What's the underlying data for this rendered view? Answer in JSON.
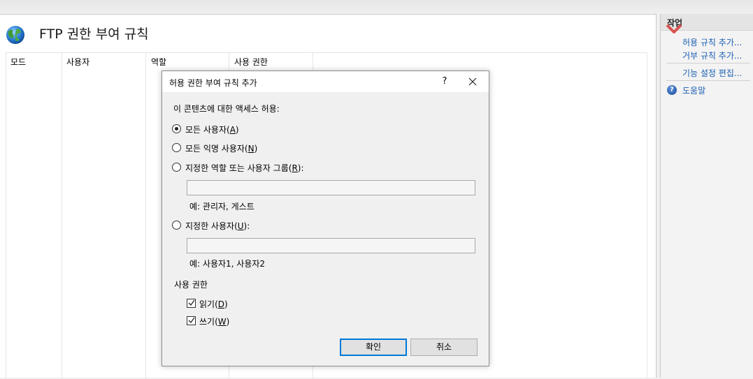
{
  "page": {
    "title": "FTP 권한 부여 규칙",
    "columns": [
      "모드",
      "사용자",
      "역할",
      "사용 권한"
    ]
  },
  "actions": {
    "title": "작업",
    "add_allow": "허용 규칙 추가...",
    "add_deny": "거부 규칙 추가...",
    "edit_settings": "기능 설정 편집...",
    "help": "도움말"
  },
  "dialog": {
    "title": "허용 권한 부여 규칙 추가",
    "help_button": "?",
    "access_label": "이 콘텐츠에 대한 액세스 허용:",
    "options": [
      {
        "label": "모든 사용자",
        "hotkey": "A",
        "checked": true
      },
      {
        "label": "모든 익명 사용자",
        "hotkey": "N",
        "checked": false
      },
      {
        "label": "지정한 역할 또는 사용자 그룹",
        "hotkey": "R",
        "suffix": ":",
        "checked": false
      },
      {
        "label": "지정한 사용자",
        "hotkey": "U",
        "suffix": ":",
        "checked": false
      }
    ],
    "roles_value": "",
    "roles_example": "예: 관리자, 게스트",
    "users_value": "",
    "users_example": "예: 사용자1, 사용자2",
    "permissions_label": "사용 권한",
    "permissions": [
      {
        "label": "읽기",
        "hotkey": "D",
        "checked": true
      },
      {
        "label": "쓰기",
        "hotkey": "W",
        "checked": true
      }
    ],
    "ok": "확인",
    "cancel": "취소"
  }
}
